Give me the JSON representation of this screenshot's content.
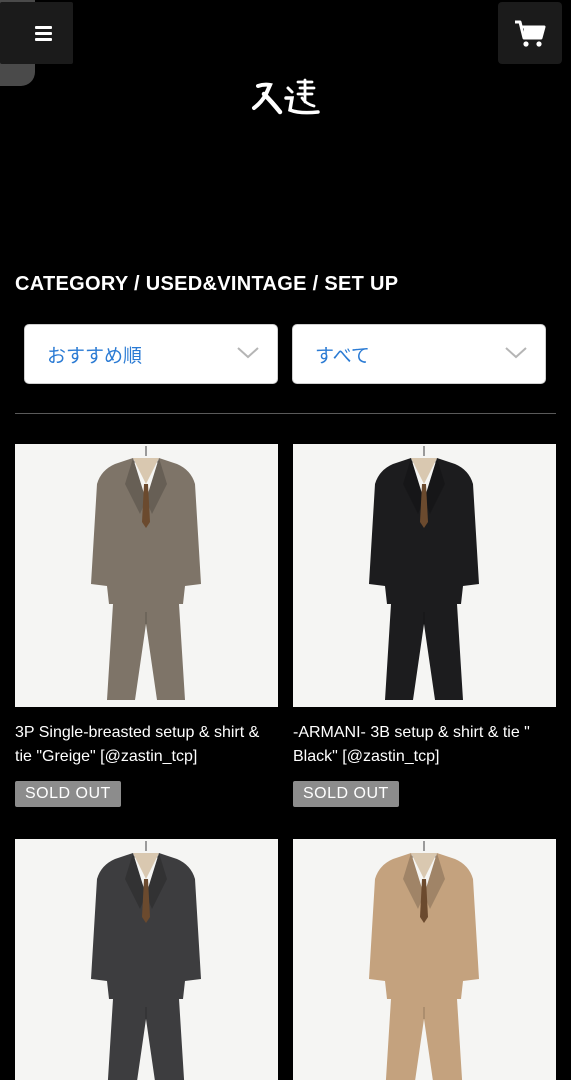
{
  "header": {
    "menu_icon": "hamburger-icon",
    "cart_icon": "cart-icon",
    "back_icon": "chevron-right-icon",
    "logo_text": "久遠"
  },
  "breadcrumb": "CATEGORY / USED&VINTAGE / SET UP",
  "filters": {
    "sort_value": "おすすめ順",
    "category_value": "すべて"
  },
  "colors": {
    "background": "#000000",
    "select_text": "#2b7bd4",
    "badge": "#8c8c8c"
  },
  "products": [
    {
      "title": "3P Single-breasted setup & shirt & tie \"Greige\" [@zastin_tcp]",
      "badge": "SOLD OUT",
      "suit_color": "#7e7468"
    },
    {
      "title": "-ARMANI- 3B setup & shirt & tie \" Black\" [@zastin_tcp]",
      "badge": "SOLD OUT",
      "suit_color": "#1c1c1e"
    },
    {
      "title": "",
      "badge": "",
      "suit_color": "#3d3d3f"
    },
    {
      "title": "",
      "badge": "",
      "suit_color": "#c4a27e"
    }
  ]
}
